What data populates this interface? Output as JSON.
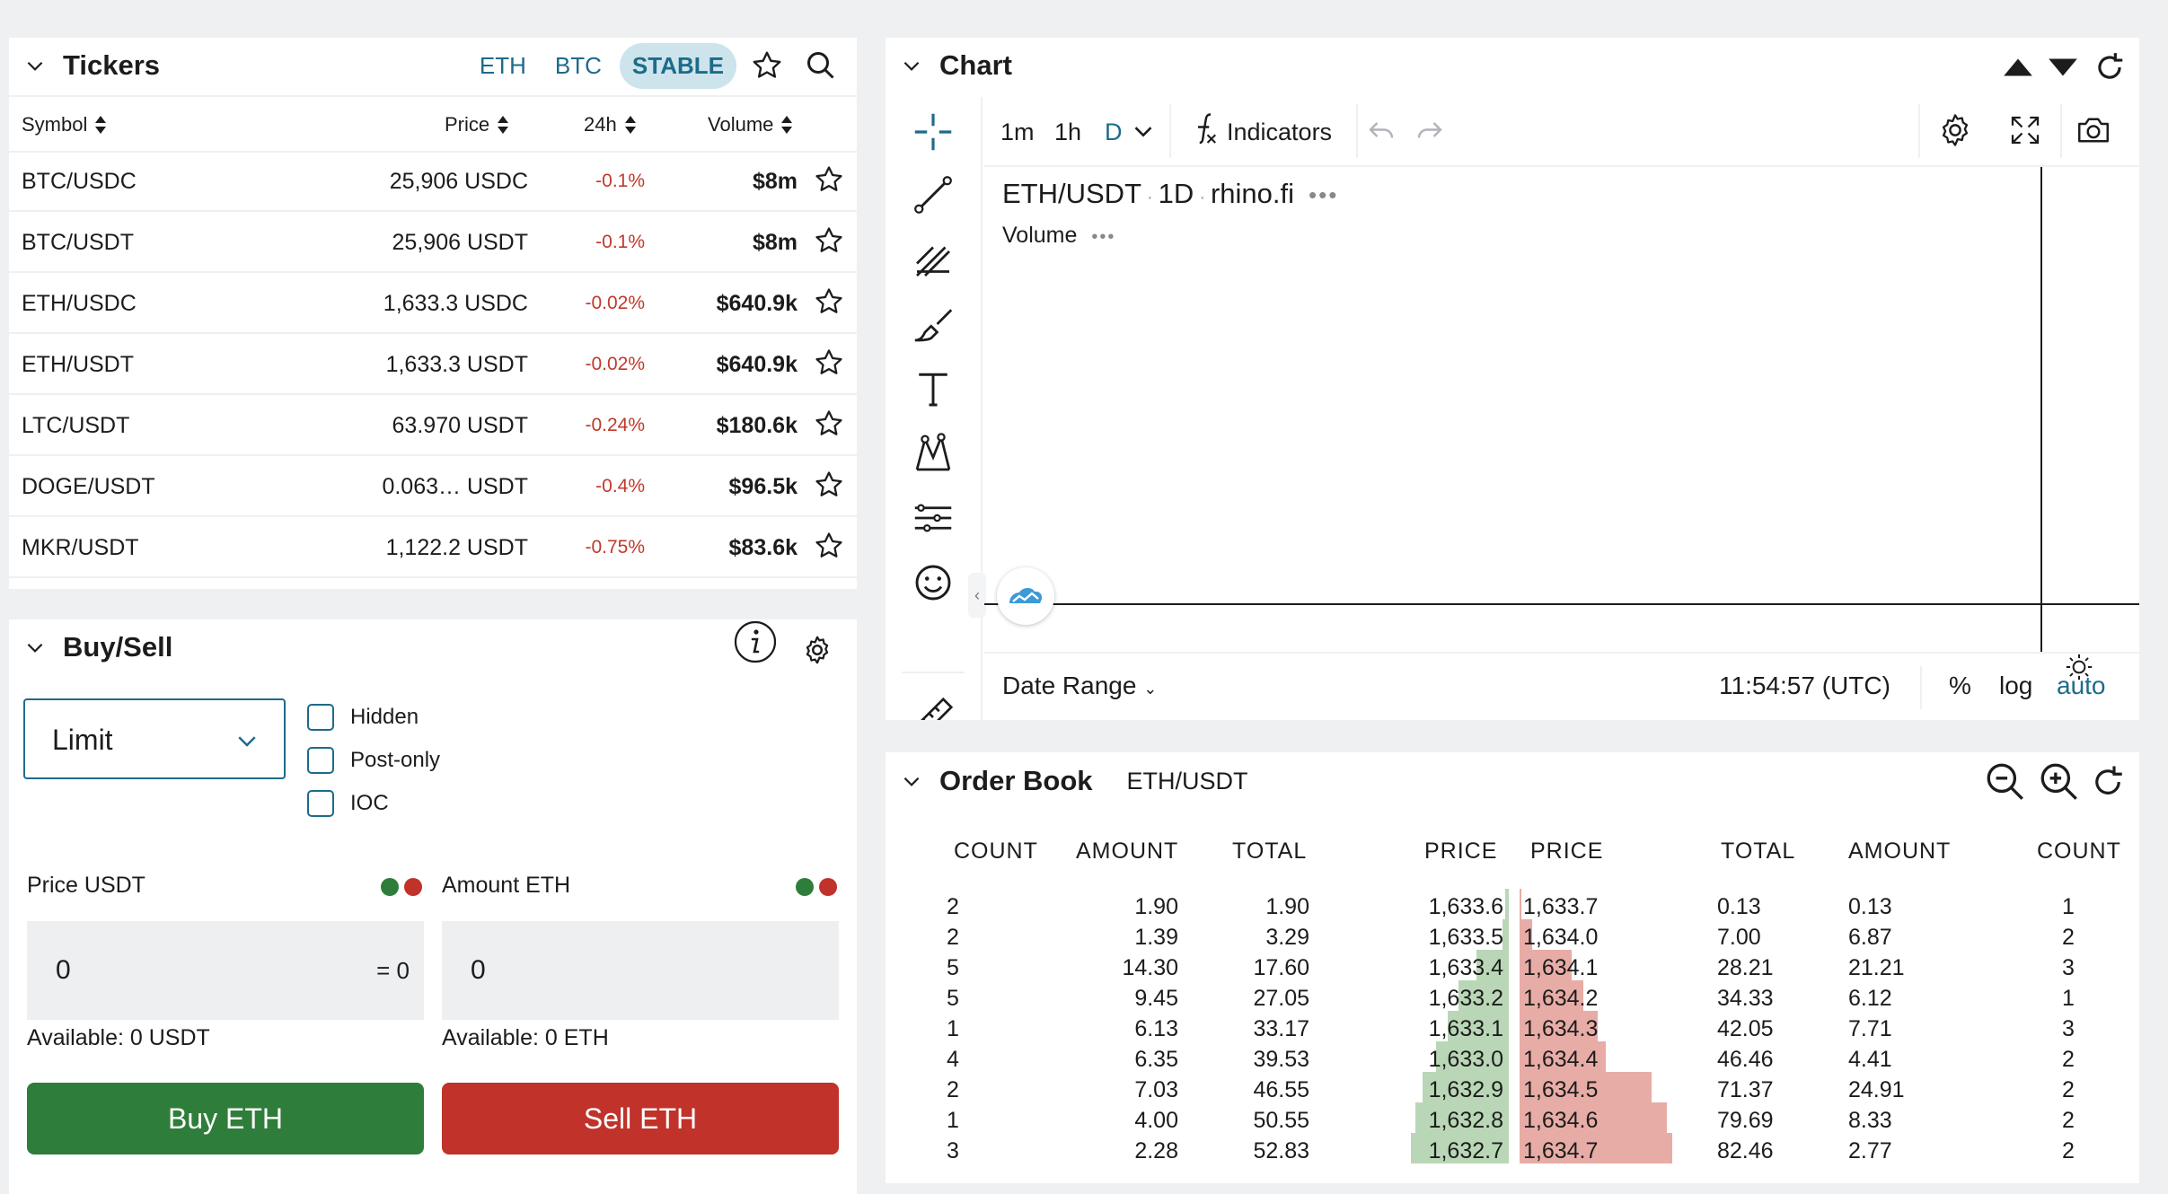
{
  "tickers": {
    "title": "Tickers",
    "tabs": [
      {
        "label": "ETH"
      },
      {
        "label": "BTC"
      },
      {
        "label": "STABLE",
        "active": true
      }
    ],
    "columns": {
      "symbol": "Symbol",
      "price": "Price",
      "change": "24h",
      "volume": "Volume"
    },
    "rows": [
      {
        "symbol": "BTC/USDC",
        "price": "25,906 USDC",
        "change": "-0.1%",
        "volume": "$8m"
      },
      {
        "symbol": "BTC/USDT",
        "price": "25,906 USDT",
        "change": "-0.1%",
        "volume": "$8m"
      },
      {
        "symbol": "ETH/USDC",
        "price": "1,633.3 USDC",
        "change": "-0.02%",
        "volume": "$640.9k"
      },
      {
        "symbol": "ETH/USDT",
        "price": "1,633.3 USDT",
        "change": "-0.02%",
        "volume": "$640.9k"
      },
      {
        "symbol": "LTC/USDT",
        "price": "63.970 USDT",
        "change": "-0.24%",
        "volume": "$180.6k"
      },
      {
        "symbol": "DOGE/USDT",
        "price": "0.063… USDT",
        "change": "-0.4%",
        "volume": "$96.5k"
      },
      {
        "symbol": "MKR/USDT",
        "price": "1,122.2 USDT",
        "change": "-0.75%",
        "volume": "$83.6k"
      }
    ]
  },
  "buysell": {
    "title": "Buy/Sell",
    "order_type": "Limit",
    "options": [
      {
        "label": "Hidden",
        "checked": false
      },
      {
        "label": "Post-only",
        "checked": false
      },
      {
        "label": "IOC",
        "checked": false
      }
    ],
    "price_label": "Price USDT",
    "amount_label": "Amount ETH",
    "price_value": "0",
    "price_total": "= 0",
    "amount_value": "0",
    "available_price": "Available: 0 USDT",
    "available_amount": "Available: 0 ETH",
    "buy_label": "Buy ETH",
    "sell_label": "Sell ETH"
  },
  "chart": {
    "title": "Chart",
    "intervals": [
      "1m",
      "1h",
      "D"
    ],
    "active_interval": "D",
    "indicators_label": "Indicators",
    "symbol": "ETH/USDT",
    "timeframe": "1D",
    "source": "rhino.fi",
    "volume_label": "Volume",
    "date_range_label": "Date Range",
    "time": "11:54:57 (UTC)",
    "percent_label": "%",
    "log_label": "log",
    "auto_label": "auto"
  },
  "orderbook": {
    "title": "Order Book",
    "pair": "ETH/USDT",
    "bid_headers": [
      "COUNT",
      "AMOUNT",
      "TOTAL",
      "PRICE"
    ],
    "ask_headers": [
      "PRICE",
      "TOTAL",
      "AMOUNT",
      "COUNT"
    ],
    "bids": [
      {
        "count": "2",
        "amount": "1.90",
        "total": "1.90",
        "price": "1,633.6"
      },
      {
        "count": "2",
        "amount": "1.39",
        "total": "3.29",
        "price": "1,633.5"
      },
      {
        "count": "5",
        "amount": "14.30",
        "total": "17.60",
        "price": "1,633.4"
      },
      {
        "count": "5",
        "amount": "9.45",
        "total": "27.05",
        "price": "1,633.2"
      },
      {
        "count": "1",
        "amount": "6.13",
        "total": "33.17",
        "price": "1,633.1"
      },
      {
        "count": "4",
        "amount": "6.35",
        "total": "39.53",
        "price": "1,633.0"
      },
      {
        "count": "2",
        "amount": "7.03",
        "total": "46.55",
        "price": "1,632.9"
      },
      {
        "count": "1",
        "amount": "4.00",
        "total": "50.55",
        "price": "1,632.8"
      },
      {
        "count": "3",
        "amount": "2.28",
        "total": "52.83",
        "price": "1,632.7"
      }
    ],
    "asks": [
      {
        "price": "1,633.7",
        "total": "0.13",
        "amount": "0.13",
        "count": "1"
      },
      {
        "price": "1,634.0",
        "total": "7.00",
        "amount": "6.87",
        "count": "2"
      },
      {
        "price": "1,634.1",
        "total": "28.21",
        "amount": "21.21",
        "count": "3"
      },
      {
        "price": "1,634.2",
        "total": "34.33",
        "amount": "6.12",
        "count": "1"
      },
      {
        "price": "1,634.3",
        "total": "42.05",
        "amount": "7.71",
        "count": "3"
      },
      {
        "price": "1,634.4",
        "total": "46.46",
        "amount": "4.41",
        "count": "2"
      },
      {
        "price": "1,634.5",
        "total": "71.37",
        "amount": "24.91",
        "count": "2"
      },
      {
        "price": "1,634.6",
        "total": "79.69",
        "amount": "8.33",
        "count": "2"
      },
      {
        "price": "1,634.7",
        "total": "82.46",
        "amount": "2.77",
        "count": "2"
      }
    ]
  },
  "colors": {
    "accent": "#1c6b8b",
    "buy": "#2f7d3a",
    "sell": "#c0322a",
    "bid_depth": "#b9d7b6",
    "ask_depth": "#e8aca6",
    "negative": "#c0392b",
    "dot_green": "#2f7d3a",
    "dot_red": "#c0322a"
  }
}
